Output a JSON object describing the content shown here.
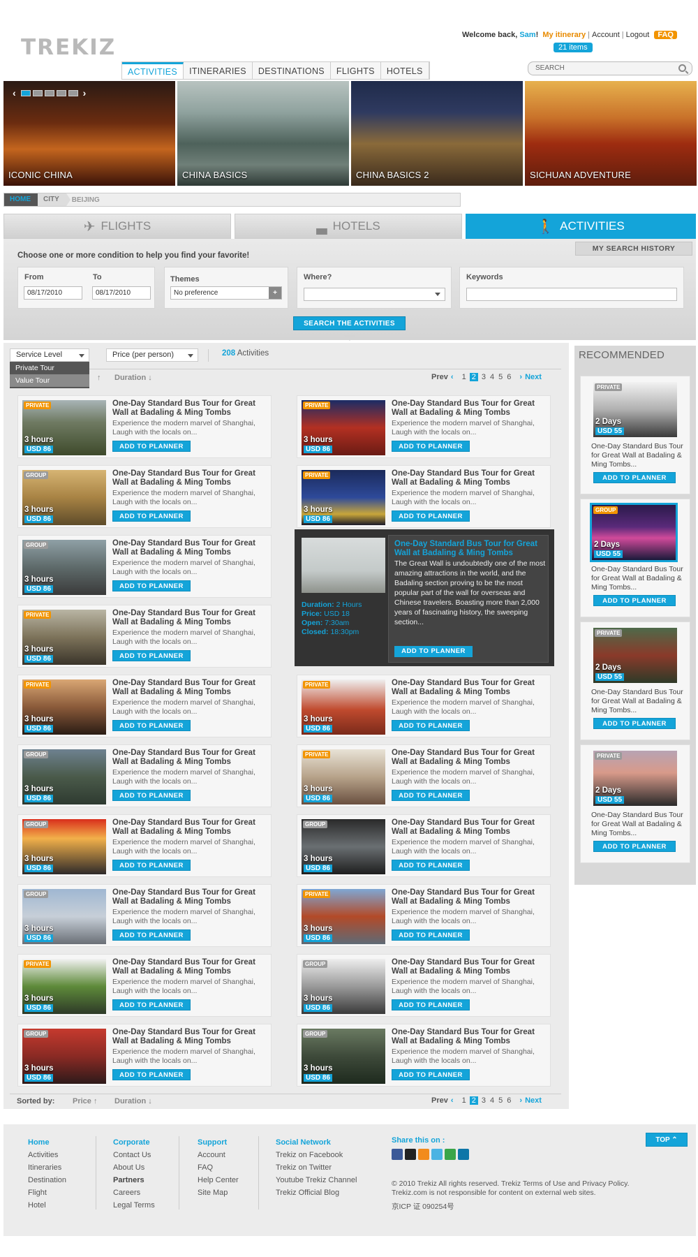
{
  "header": {
    "logo": "TREKIZ",
    "welcome_prefix": "Welcome back,",
    "user": "Sam",
    "welcome_suffix": "!",
    "itinerary": "My itinerary",
    "account": "Account",
    "logout": "Logout",
    "faq": "FAQ",
    "items_badge": "21 items",
    "search_placeholder": "SEARCH"
  },
  "nav": [
    "ACTIVITIES",
    "ITINERARIES",
    "DESTINATIONS",
    "FLIGHTS",
    "HOTELS"
  ],
  "hero": [
    "ICONIC CHINA",
    "CHINA BASICS",
    "CHINA BASICS 2",
    "SICHUAN ADVENTURE"
  ],
  "breadcrumb": {
    "home": "HOME",
    "city": "CITY",
    "current": "BEIJING"
  },
  "tabs": {
    "flights": "FLIGHTS",
    "hotels": "HOTELS",
    "activities": "ACTIVITIES"
  },
  "search": {
    "history": "MY SEARCH HISTORY",
    "prompt": "Choose one or more condition to help you find your favorite!",
    "from_label": "From",
    "from_value": "08/17/2010",
    "to_label": "To",
    "to_value": "08/17/2010",
    "themes_label": "Themes",
    "themes_value": "No preference",
    "where_label": "Where?",
    "keywords_label": "Keywords",
    "button": "SEARCH THE ACTIVITIES"
  },
  "filters": {
    "service_level": "Service Level",
    "price": "Price (per person)",
    "count": "208",
    "count_label": "Activities",
    "dropdown_options": [
      "Private Tour",
      "Value Tour"
    ]
  },
  "sort": {
    "label": "Sorted by:",
    "price": "Price",
    "duration": "Duration"
  },
  "pager": {
    "prev": "Prev",
    "next": "Next",
    "pages": [
      "1",
      "2",
      "3",
      "4",
      "5",
      "6"
    ],
    "current": "2"
  },
  "activity_title": "One-Day Standard Bus Tour for Great Wall at Badaling & Ming Tombs",
  "activity_desc": "Experience the modern marvel of Shanghai, Laugh with the locals on...",
  "duration": "3 hours",
  "price": "USD 86",
  "add_label": "ADD TO PLANNER",
  "tag_private": "PRIVATE",
  "tag_group": "GROUP",
  "preview": {
    "title": "One-Day Standard Bus Tour for Great Wall at Badaling & Ming Tombs",
    "desc": "The Great Wall is undoubtedly one of the most amazing attractions in the world, and the Badaling section proving to be the most popular part of the wall for overseas and Chinese travelers. Boasting more than 2,000 years of fascinating history, the sweeping section...",
    "duration_label": "Duration:",
    "duration_value": "2 Hours",
    "price_label": "Price:",
    "price_value": "USD  18",
    "open_label": "Open:",
    "open_value": "7:30am",
    "closed_label": "Closed:",
    "closed_value": "18:30pm"
  },
  "recommended": {
    "title": "RECOMMENDED",
    "duration": "2 Days",
    "price": "USD 55",
    "item_title": "One-Day Standard Bus Tour for Great Wall at Badaling & Ming Tombs..."
  },
  "footer": {
    "home": {
      "title": "Home",
      "links": [
        "Activities",
        "Itineraries",
        "Destination",
        "Flight",
        "Hotel"
      ]
    },
    "corporate": {
      "title": "Corporate",
      "links": [
        "Contact Us",
        "About Us",
        "Partners",
        "Careers",
        "Legal Terms"
      ]
    },
    "support": {
      "title": "Support",
      "links": [
        "Account",
        "FAQ",
        "Help Center",
        "Site Map"
      ]
    },
    "social": {
      "title": "Social Network",
      "links": [
        "Trekiz on Facebook",
        "Trekiz on Twitter",
        "Youtube Trekiz Channel",
        "Trekiz Official Blog"
      ]
    },
    "share": "Share this on :",
    "copyright": "© 2010 Trekiz All rights reserved. Trekiz Terms of Use and Privacy Policy. Trekiz.com is not responsible for content on external web sites.",
    "icp": "京ICP 证 090254号",
    "top": "TOP"
  },
  "colors": {
    "accent": "#14a4d9",
    "orange": "#f29400"
  }
}
